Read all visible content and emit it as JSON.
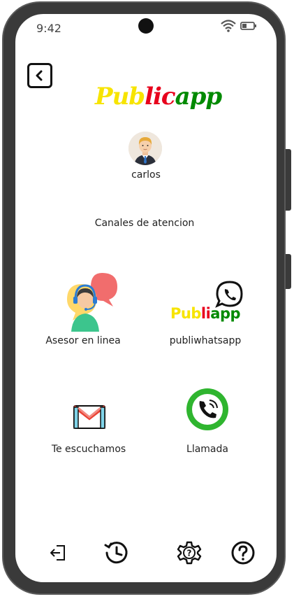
{
  "status_bar": {
    "time": "9:42",
    "icons": [
      "wifi-icon",
      "battery-icon"
    ]
  },
  "header": {
    "back_icon": "chevron-left-icon",
    "logo": {
      "part1": "Pub",
      "part2": "lic",
      "part3": "app"
    }
  },
  "user": {
    "name": "carlos",
    "avatar_icon": "user-avatar"
  },
  "section_title": "Canales de atencion",
  "channels": [
    {
      "label": "Asesor en linea",
      "icon": "support-agent-icon"
    },
    {
      "label": "publiwhatsapp",
      "icon": "whatsapp-icon",
      "logo": {
        "part1": "Pub",
        "part2": "li",
        "part3": "app"
      }
    },
    {
      "label": "Te escuchamos",
      "icon": "gmail-icon"
    },
    {
      "label": "Llamada",
      "icon": "phone-call-icon"
    }
  ],
  "bottom_nav": [
    {
      "icon": "logout-icon"
    },
    {
      "icon": "history-icon"
    },
    {
      "icon": "settings-icon"
    },
    {
      "icon": "help-icon"
    }
  ],
  "colors": {
    "logo_yellow": "#f7e400",
    "logo_red": "#e8001c",
    "logo_green": "#008a00",
    "call_green": "#2fb52f"
  }
}
